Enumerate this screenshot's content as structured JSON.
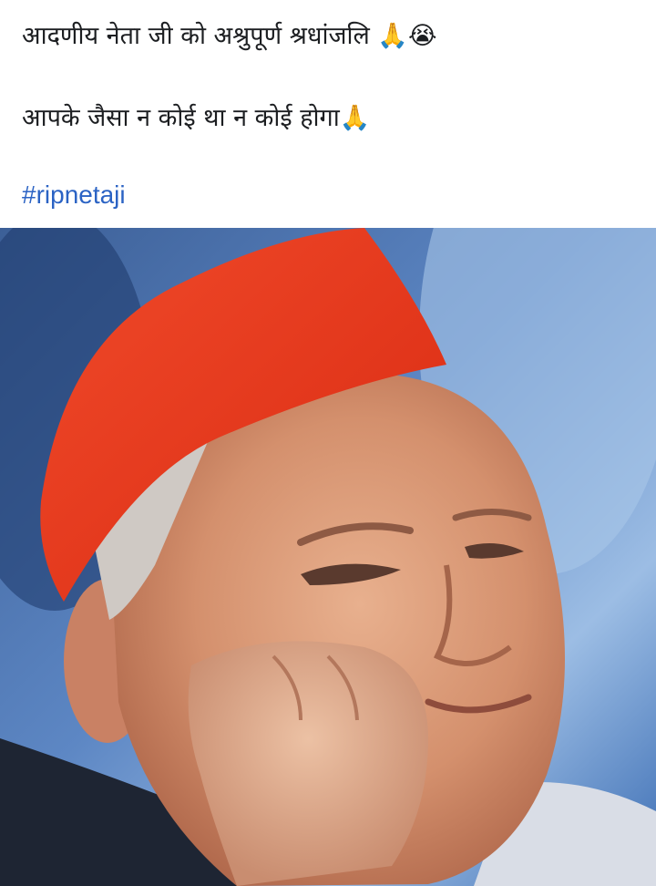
{
  "post": {
    "line1_text": "आदणीय नेता जी को अश्रुपूर्ण श्रधांजलि",
    "line1_emojis": "🙏😭",
    "line2_text": "आपके जैसा न कोई था न कोई होगा",
    "line2_emoji": "🙏",
    "hashtag": "#ripnetaji"
  },
  "colors": {
    "hashtag": "#2b63c4",
    "text": "#1c1e21",
    "cap": "#e8331c"
  },
  "photo": {
    "icon": "photo-portrait"
  }
}
